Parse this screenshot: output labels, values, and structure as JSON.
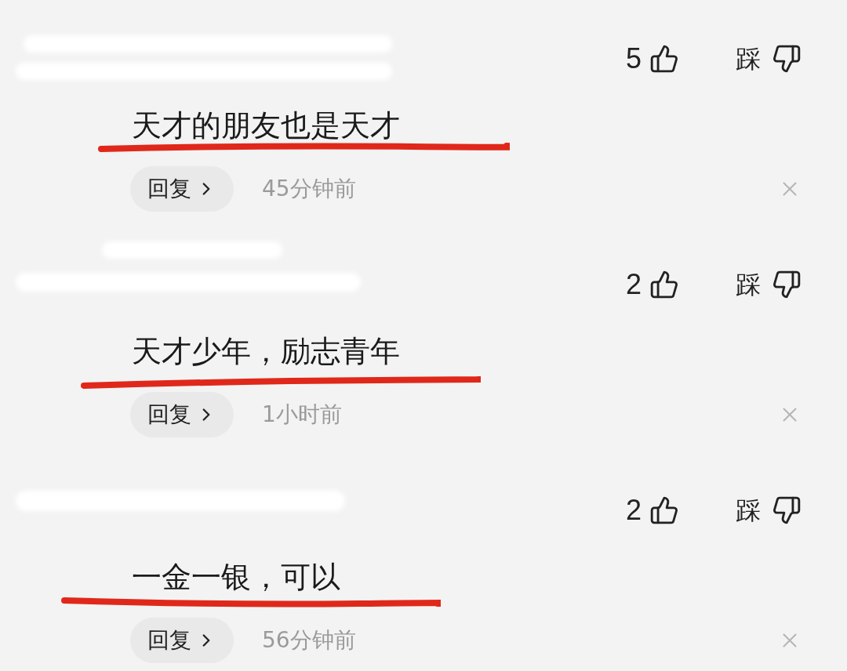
{
  "comments": [
    {
      "likes": "5",
      "dislike_label": "踩",
      "text": "天才的朋友也是天才",
      "reply_label": "回复",
      "time": "45分钟前"
    },
    {
      "likes": "2",
      "dislike_label": "踩",
      "text": "天才少年，励志青年",
      "reply_label": "回复",
      "time": "1小时前"
    },
    {
      "likes": "2",
      "dislike_label": "踩",
      "text": "一金一银，可以",
      "reply_label": "回复",
      "time": "56分钟前"
    }
  ]
}
